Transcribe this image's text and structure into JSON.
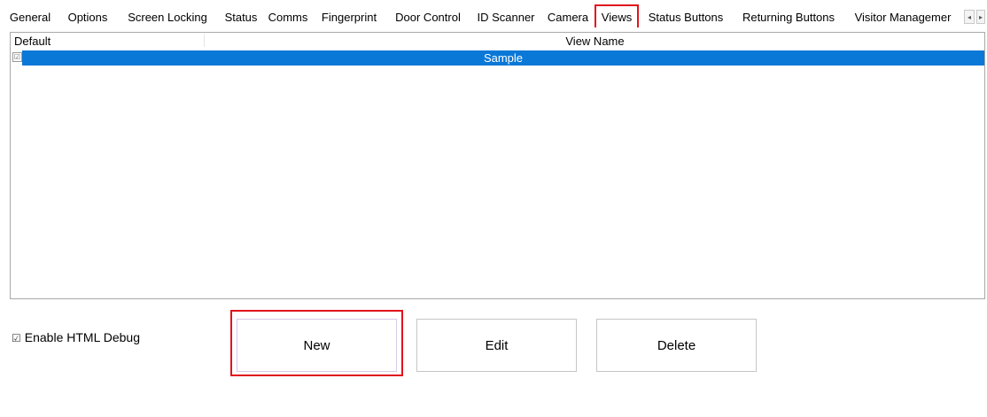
{
  "tabs": [
    {
      "label": "General",
      "active": false
    },
    {
      "label": "Options",
      "active": false
    },
    {
      "label": "Screen Locking",
      "active": false
    },
    {
      "label": "Status",
      "active": false
    },
    {
      "label": "Comms",
      "active": false
    },
    {
      "label": "Fingerprint",
      "active": false
    },
    {
      "label": "Door Control",
      "active": false
    },
    {
      "label": "ID Scanner",
      "active": false
    },
    {
      "label": "Camera",
      "active": false
    },
    {
      "label": "Views",
      "active": true
    },
    {
      "label": "Status Buttons",
      "active": false
    },
    {
      "label": "Returning Buttons",
      "active": false
    },
    {
      "label": "Visitor Managemer",
      "active": false
    }
  ],
  "tab_scroll_icon": "chevron-left-icon",
  "views_list": {
    "columns": {
      "default": "Default",
      "view_name": "View Name"
    },
    "rows": [
      {
        "default_checked": true,
        "check_glyph": "☑",
        "view_name": "Sample",
        "selected": true
      }
    ]
  },
  "debug_option": {
    "glyph": "☑",
    "label": "Enable HTML Debug",
    "checked": true
  },
  "buttons": {
    "new_label": "New",
    "edit_label": "Edit",
    "delete_label": "Delete"
  },
  "colors": {
    "selection": "#0a78d7",
    "highlight": "#e0141c"
  }
}
